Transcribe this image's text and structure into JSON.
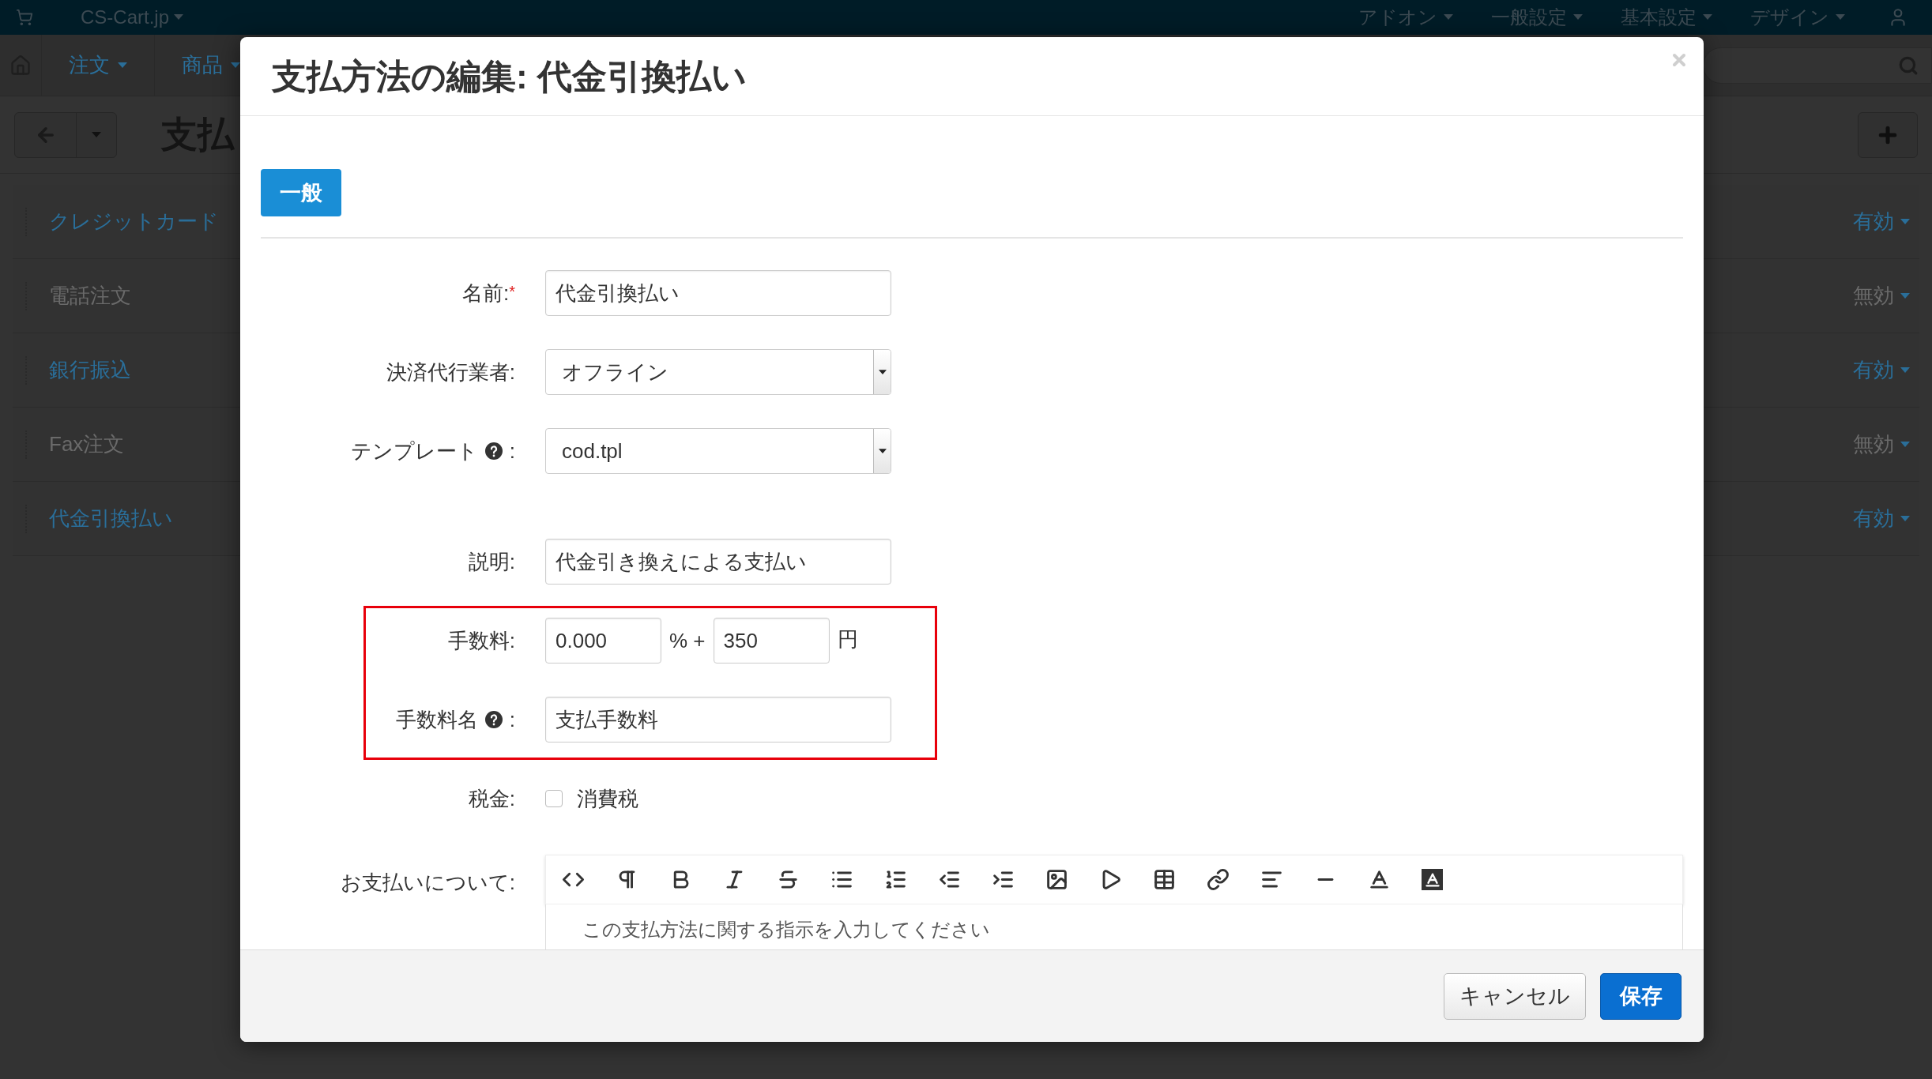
{
  "top_bar": {
    "store": "CS-Cart.jp",
    "menu": [
      "アドオン",
      "一般設定",
      "基本設定",
      "デザイン"
    ]
  },
  "nav": {
    "menu": [
      "注文",
      "商品"
    ]
  },
  "page": {
    "title": "支払"
  },
  "payment_methods": [
    {
      "name": "クレジットカード",
      "status": "有効",
      "enabled": true
    },
    {
      "name": "電話注文",
      "status": "無効",
      "enabled": false
    },
    {
      "name": "銀行振込",
      "status": "有効",
      "enabled": true
    },
    {
      "name": "Fax注文",
      "status": "無効",
      "enabled": false
    },
    {
      "name": "代金引換払い",
      "status": "有効",
      "enabled": true
    }
  ],
  "dialog": {
    "title": "支払方法の編集: 代金引換払い",
    "tabs": [
      {
        "label": "一般",
        "selected": true
      }
    ],
    "fields": [
      {
        "kind": "text",
        "label": "名前:",
        "required_mark": "*",
        "value": "代金引換払い"
      },
      {
        "kind": "select",
        "label": "決済代行業者:",
        "value": "オフライン"
      },
      {
        "kind": "select",
        "label": "テンプレート",
        "help": true,
        "label_end": ":",
        "value": "cod.tpl"
      },
      {
        "kind": "text",
        "label": "説明:",
        "value": "代金引き換えによる支払い"
      },
      {
        "kind": "fee",
        "label": "手数料:",
        "percent_value": "0.000",
        "percent_sign": "% +",
        "amount_value": "350",
        "currency": "円",
        "annotated": true
      },
      {
        "kind": "text",
        "label": "手数料名",
        "help": true,
        "label_end": ":",
        "value": "支払手数料",
        "annotated": true
      },
      {
        "kind": "checkbox",
        "label": "税金:",
        "option": "消費税",
        "checked": false
      },
      {
        "kind": "editor",
        "label": "お支払いについて:",
        "placeholder": "この支払方法に関する指示を入力してください"
      }
    ],
    "buttons": [
      {
        "label": "キャンセル",
        "kind": "default"
      },
      {
        "label": "保存",
        "kind": "primary"
      }
    ]
  }
}
